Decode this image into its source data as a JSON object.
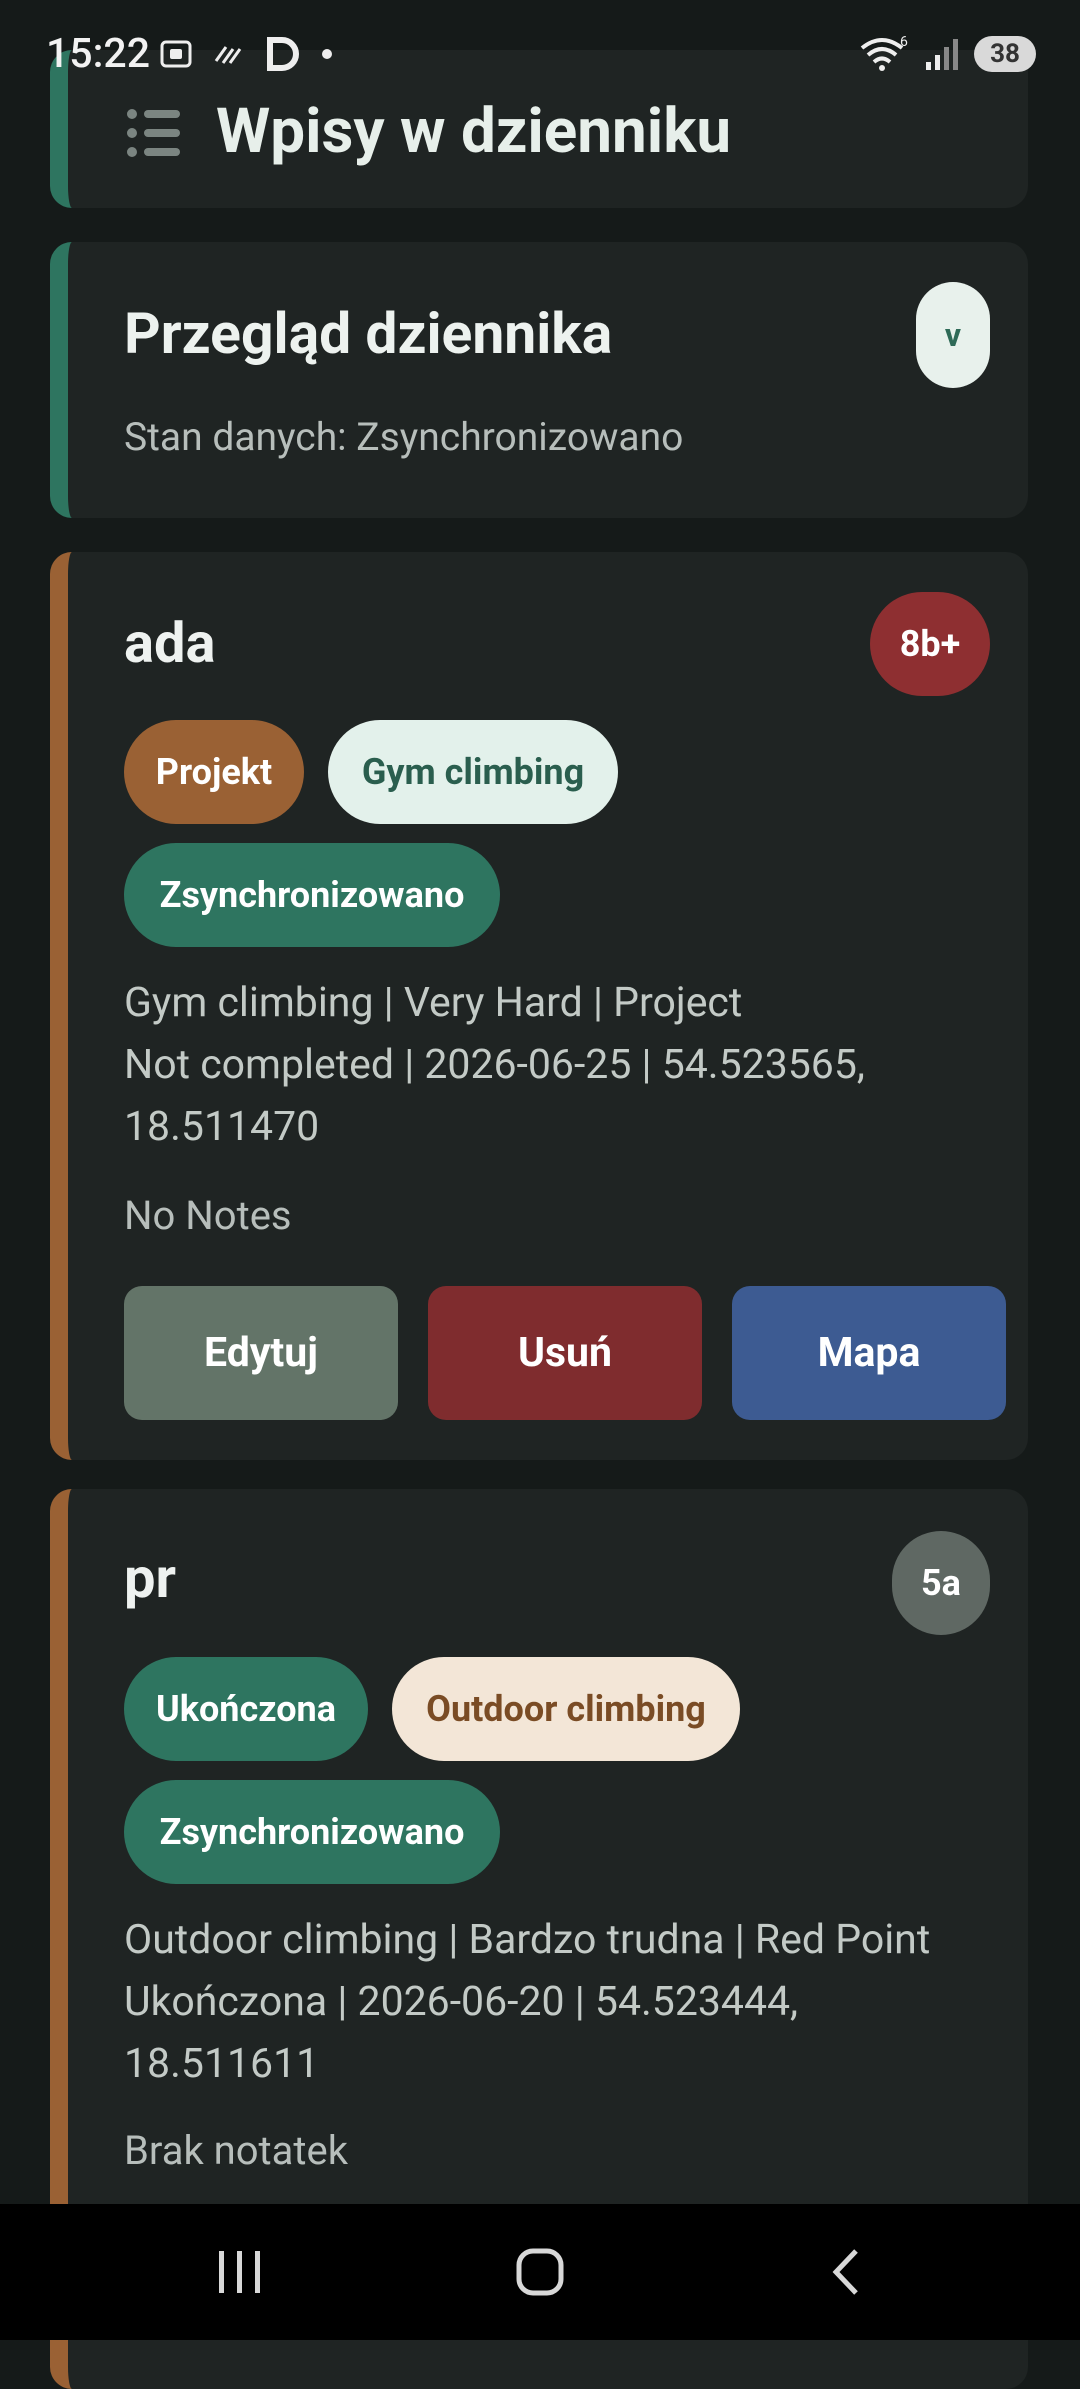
{
  "status_bar": {
    "time": "15:22",
    "battery": "38"
  },
  "header": {
    "title": "Wpisy w dzienniku"
  },
  "overview": {
    "title": "Przegląd dziennika",
    "status": "Stan danych: Zsynchronizowano",
    "pill": "v"
  },
  "entries": [
    {
      "name": "ada",
      "grade": "8b+",
      "chips": [
        "Projekt",
        "Gym climbing",
        "Zsynchronizowano"
      ],
      "details_line1": "Gym climbing | Very Hard | Project",
      "details_line2": "Not completed | 2026-06-25 | 54.523565,",
      "details_line3": "18.511470",
      "notes": "No Notes",
      "buttons": {
        "edit": "Edytuj",
        "delete": "Usuń",
        "map": "Mapa"
      }
    },
    {
      "name": "pr",
      "grade": "5a",
      "chips": [
        "Ukończona",
        "Outdoor climbing",
        "Zsynchronizowano"
      ],
      "details_line1": "Outdoor climbing | Bardzo trudna | Red Point",
      "details_line2": "Ukończona | 2026-06-20 | 54.523444,",
      "details_line3": "18.511611",
      "notes": "Brak notatek"
    }
  ],
  "colors": {
    "background": "#151a19",
    "card": "#1f2423",
    "accent_green": "#2e7560",
    "accent_brown": "#9a6134",
    "grade_red": "#8e2f31",
    "grade_gray": "#5f6863"
  }
}
